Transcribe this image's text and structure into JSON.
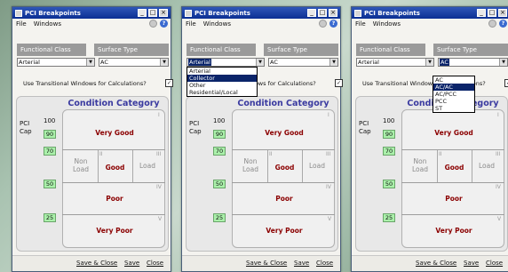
{
  "window": {
    "title": "PCI Breakpoints",
    "minimize": "_",
    "maximize": "□",
    "close": "×"
  },
  "menu": {
    "file": "File",
    "windows": "Windows"
  },
  "form": {
    "functional_class_label": "Functional Class",
    "surface_type_label": "Surface Type",
    "transitional_label": "Use Transitional Windows for Calculations?",
    "transitional_checked": "✓"
  },
  "windows": [
    {
      "functional_class_value": "Arterial",
      "surface_type_value": "AC"
    },
    {
      "functional_class_value": "Arterial",
      "surface_type_value": "AC"
    },
    {
      "functional_class_value": "Arterial",
      "surface_type_value": "AC"
    }
  ],
  "dropdown_functional_class": {
    "options": [
      "Arterial",
      "Collector",
      "Other",
      "Residential/Local"
    ],
    "highlighted": "Collector"
  },
  "dropdown_surface_type": {
    "options": [
      "AC",
      "AC/AC",
      "AC/PCC",
      "PCC",
      "ST"
    ],
    "highlighted": "AC/AC"
  },
  "condition": {
    "title": "Condition Category",
    "pci_label": "PCI",
    "cap_label": "Cap",
    "top_value": "100",
    "breakpoints": [
      "90",
      "70",
      "50",
      "25"
    ],
    "zones": {
      "I": "Very Good",
      "II_left": "Non",
      "II_left2": "Load",
      "II_mid": "Good",
      "III": "Load",
      "IV": "Poor",
      "V": "Very Poor"
    },
    "roman": [
      "I",
      "II",
      "III",
      "IV",
      "V"
    ]
  },
  "footer": {
    "save_close": "Save & Close",
    "save": "Save",
    "close": "Close"
  }
}
